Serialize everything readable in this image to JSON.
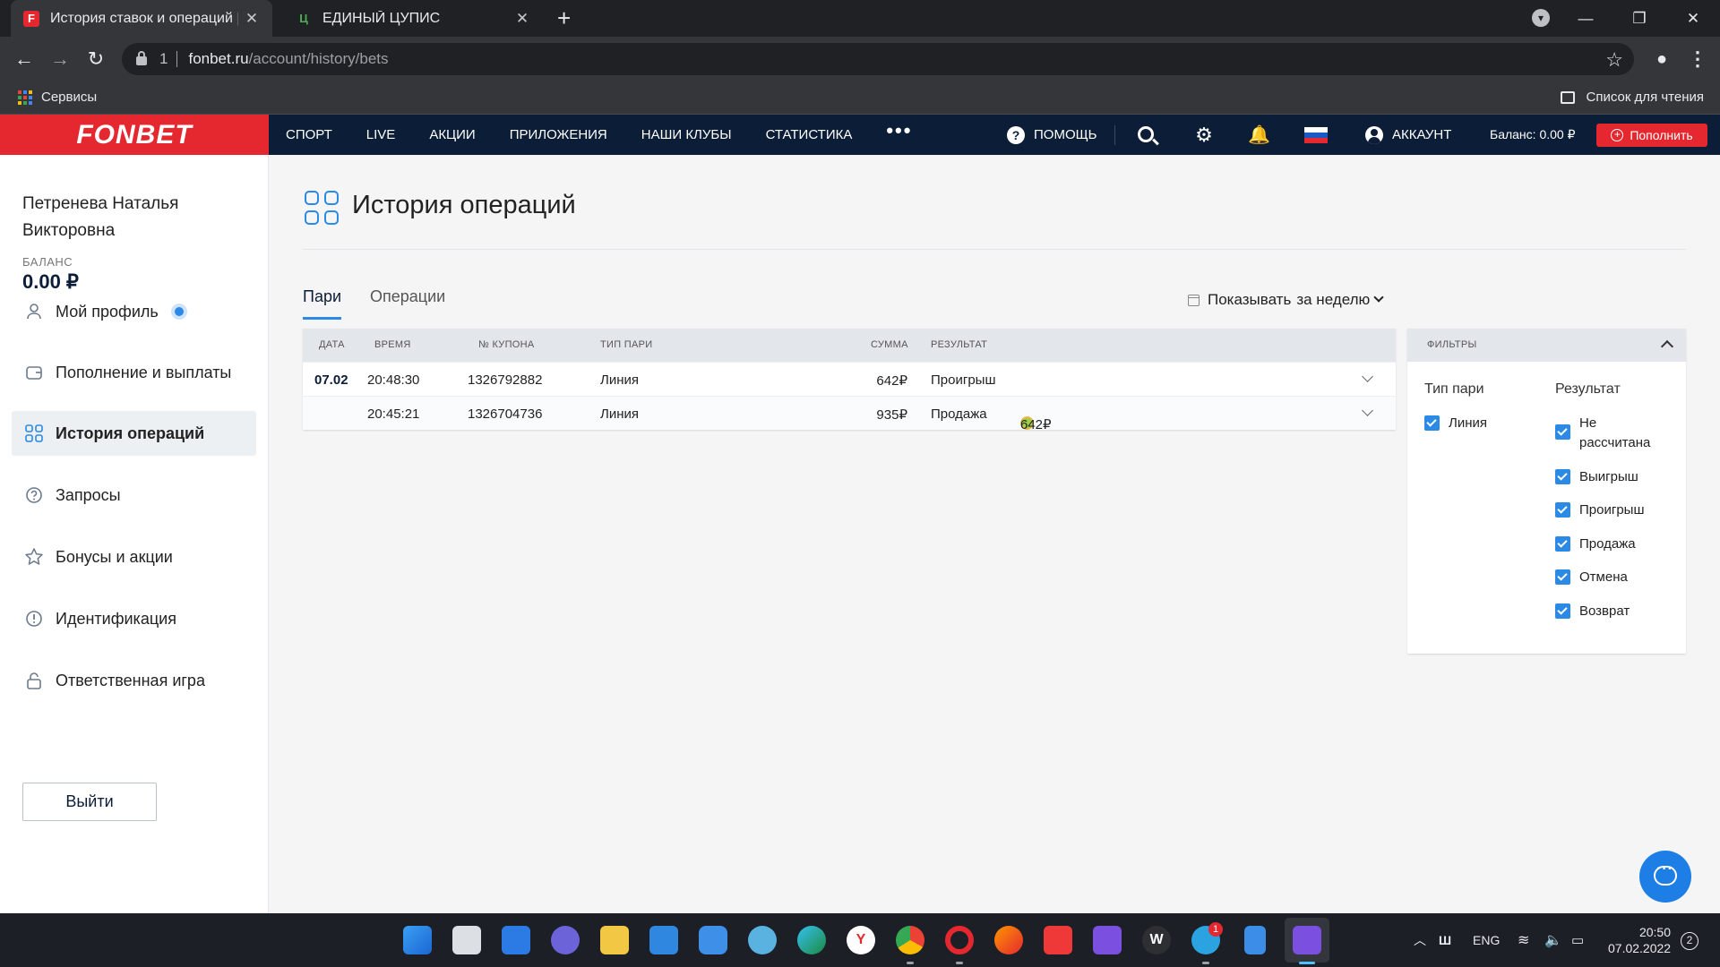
{
  "browser": {
    "tabs": [
      {
        "title": "История ставок и операций | Фо",
        "favicon": "F"
      },
      {
        "title": "ЕДИНЫЙ ЦУПИС",
        "favicon": "Ц"
      }
    ],
    "url_tab_count": "1",
    "url_host": "fonbet.ru",
    "url_path": "/account/history/bets",
    "bookmarks_apps": "Сервисы",
    "reading_list": "Список для чтения"
  },
  "header": {
    "logo": "FONBET",
    "nav": [
      "СПОРТ",
      "LIVE",
      "АКЦИИ",
      "ПРИЛОЖЕНИЯ",
      "НАШИ КЛУБЫ",
      "СТАТИСТИКА"
    ],
    "more": "•••",
    "help": "ПОМОЩЬ",
    "account": "АККАУНТ",
    "balance": "Баланс: 0.00 ₽",
    "topup": "Пополнить"
  },
  "sidebar": {
    "user_name": "Петренева Наталья Викторовна",
    "balance_label": "БАЛАНС",
    "balance_value": "0.00 ₽",
    "menu": [
      {
        "label": "Мой профиль",
        "icon": "user-icon"
      },
      {
        "label": "Пополнение и выплаты",
        "icon": "wallet-icon"
      },
      {
        "label": "История операций",
        "icon": "grid-icon"
      },
      {
        "label": "Запросы",
        "icon": "question-icon"
      },
      {
        "label": "Бонусы и акции",
        "icon": "star-icon"
      },
      {
        "label": "Идентификация",
        "icon": "alert-icon"
      },
      {
        "label": "Ответственная игра",
        "icon": "lock-icon"
      }
    ],
    "logout": "Выйти"
  },
  "main": {
    "title": "История операций",
    "tabs": [
      "Пари",
      "Операции"
    ],
    "period_label": "Показывать",
    "period_value": "за неделю",
    "table_headers": [
      "ДАТА",
      "ВРЕМЯ",
      "№ КУПОНА",
      "ТИП ПАРИ",
      "СУММА",
      "РЕЗУЛЬТАТ"
    ],
    "rows": [
      {
        "date": "07.02",
        "time": "20:48:30",
        "coupon": "1326792882",
        "type": "Линия",
        "sum": "642₽",
        "result": "Проигрыш",
        "payout": ""
      },
      {
        "date": "",
        "time": "20:45:21",
        "coupon": "1326704736",
        "type": "Линия",
        "sum": "935₽",
        "result": "Продажа",
        "payout": "642₽"
      }
    ]
  },
  "filters": {
    "title": "ФИЛЬТРЫ",
    "type_title": "Тип пари",
    "result_title": "Результат",
    "type_items": [
      "Линия"
    ],
    "result_items": [
      "Не рассчитана",
      "Выигрыш",
      "Проигрыш",
      "Продажа",
      "Отмена",
      "Возврат"
    ]
  },
  "taskbar": {
    "lang": "ENG",
    "time": "20:50",
    "date": "07.02.2022",
    "notifications": "2",
    "telegram_badge": "1"
  },
  "colors": {
    "brand_red": "#e5282f",
    "header_navy": "#0c1d37",
    "accent_blue": "#2a8ae6"
  }
}
